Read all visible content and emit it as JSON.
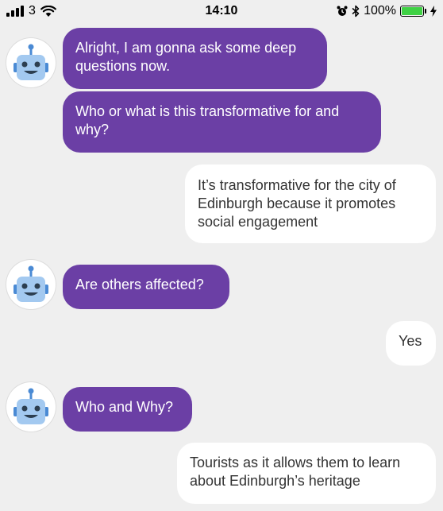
{
  "status_bar": {
    "carrier": "3",
    "time": "14:10",
    "battery_percent": "100%",
    "battery_color": "#3fd144"
  },
  "colors": {
    "bot_bubble": "#6b3fa5",
    "user_bubble": "#ffffff",
    "background": "#efefef"
  },
  "messages": [
    {
      "sender": "bot",
      "text": "Alright, I am gonna ask some deep questions now."
    },
    {
      "sender": "bot",
      "text": "Who or what is this transformative for and why?"
    },
    {
      "sender": "user",
      "text": "It’s transformative for the city of Edinburgh because it promotes social engagement"
    },
    {
      "sender": "bot",
      "text": "Are others affected?"
    },
    {
      "sender": "user",
      "text": "Yes"
    },
    {
      "sender": "bot",
      "text": "Who and Why?"
    },
    {
      "sender": "user",
      "text": "Tourists as it allows them to learn about Edinburgh’s heritage"
    }
  ],
  "avatar_icon": "robot-icon"
}
